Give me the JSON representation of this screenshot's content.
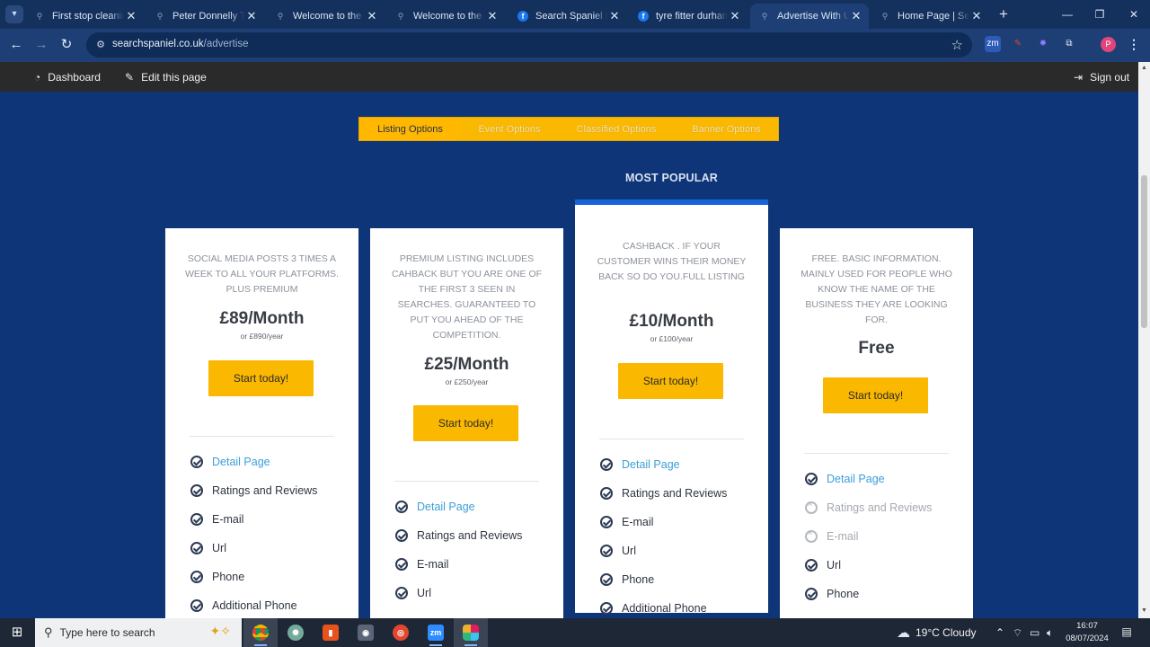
{
  "browser": {
    "tabs": [
      {
        "title": "First stop cleaning",
        "favicon": "pin-icon",
        "active": false
      },
      {
        "title": "Peter Donnelly Tyres",
        "favicon": "pin-icon",
        "active": false
      },
      {
        "title": "Welcome to the Search Spaniel",
        "favicon": "pin-icon",
        "active": false
      },
      {
        "title": "Welcome to the Search Spaniel",
        "favicon": "pin-icon",
        "active": false
      },
      {
        "title": "Search Spaniel Durham",
        "favicon": "facebook-icon",
        "active": false
      },
      {
        "title": "tyre fitter durham",
        "favicon": "facebook-icon",
        "active": false
      },
      {
        "title": "Advertise With Us",
        "favicon": "pin-icon",
        "active": true
      },
      {
        "title": "Home Page | Search Spaniel",
        "favicon": "pin-icon",
        "active": false
      }
    ],
    "url_host": "searchspaniel.co.uk",
    "url_path": "/advertise",
    "profile_initial": "P"
  },
  "adminbar": {
    "dashboard": "Dashboard",
    "edit": "Edit this page",
    "signout": "Sign out"
  },
  "option_tabs": [
    "Listing Options",
    "Event Options",
    "Classified Options",
    "Banner Options"
  ],
  "most_popular": "MOST POPULAR",
  "plans": [
    {
      "description": "SOCIAL MEDIA POSTS 3 TIMES A WEEK TO ALL YOUR PLATFORMS. PLUS PREMIUM",
      "price": "£89/Month",
      "yearly": "or £890/year",
      "cta": "Start today!",
      "features": [
        {
          "label": "Detail Page",
          "state": "link"
        },
        {
          "label": "Ratings and Reviews",
          "state": "on"
        },
        {
          "label": "E-mail",
          "state": "on"
        },
        {
          "label": "Url",
          "state": "on"
        },
        {
          "label": "Phone",
          "state": "on"
        },
        {
          "label": "Additional Phone",
          "state": "on"
        }
      ]
    },
    {
      "description": "PREMIUM LISTING INCLUDES CAHBACK BUT YOU ARE ONE OF THE FIRST 3 SEEN IN SEARCHES. GUARANTEED TO PUT YOU AHEAD OF THE COMPETITION.",
      "price": "£25/Month",
      "yearly": "or £250/year",
      "cta": "Start today!",
      "features": [
        {
          "label": "Detail Page",
          "state": "link"
        },
        {
          "label": "Ratings and Reviews",
          "state": "on"
        },
        {
          "label": "E-mail",
          "state": "on"
        },
        {
          "label": "Url",
          "state": "on"
        }
      ]
    },
    {
      "description": "CASHBACK . IF YOUR CUSTOMER WINS THEIR MONEY BACK SO DO YOU.FULL LISTING",
      "price": "£10/Month",
      "yearly": "or £100/year",
      "cta": "Start today!",
      "features": [
        {
          "label": "Detail Page",
          "state": "link"
        },
        {
          "label": "Ratings and Reviews",
          "state": "on"
        },
        {
          "label": "E-mail",
          "state": "on"
        },
        {
          "label": "Url",
          "state": "on"
        },
        {
          "label": "Phone",
          "state": "on"
        },
        {
          "label": "Additional Phone",
          "state": "on"
        }
      ]
    },
    {
      "description": "FREE. BASIC INFORMATION. MAINLY USED FOR PEOPLE WHO KNOW THE NAME OF THE BUSINESS THEY ARE LOOKING FOR.",
      "price": "Free",
      "yearly": "",
      "cta": "Start today!",
      "features": [
        {
          "label": "Detail Page",
          "state": "link"
        },
        {
          "label": "Ratings and Reviews",
          "state": "off"
        },
        {
          "label": "E-mail",
          "state": "off"
        },
        {
          "label": "Url",
          "state": "on"
        },
        {
          "label": "Phone",
          "state": "on"
        }
      ]
    }
  ],
  "taskbar": {
    "search_placeholder": "Type here to search",
    "weather": "19°C  Cloudy",
    "time": "16:07",
    "date": "08/07/2024"
  },
  "colors": {
    "page_bg": "#0e3578",
    "accent": "#fbb800",
    "popular_bar": "#1565d8",
    "link": "#3b9fd8"
  }
}
